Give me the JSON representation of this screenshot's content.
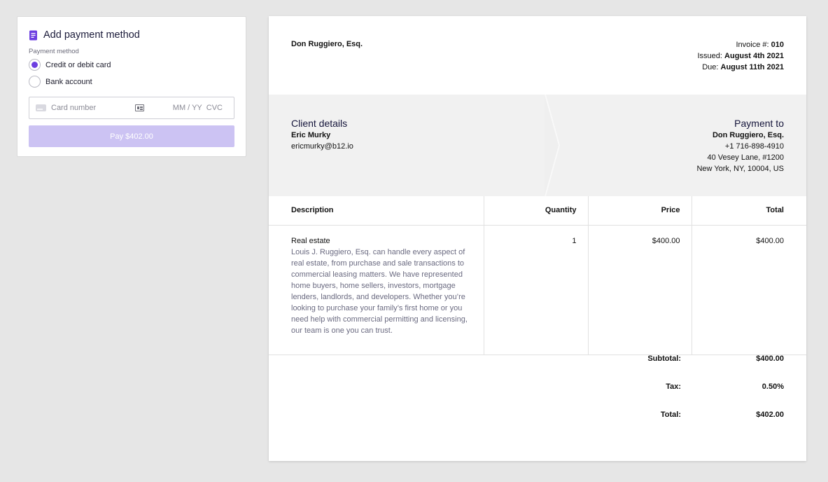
{
  "payment": {
    "title": "Add payment method",
    "method_label": "Payment method",
    "options": [
      {
        "label": "Credit or debit card",
        "selected": true
      },
      {
        "label": "Bank account",
        "selected": false
      }
    ],
    "card_number_placeholder": "Card number",
    "expiry_placeholder": "MM / YY",
    "cvc_placeholder": "CVC",
    "pay_button": "Pay $402.00",
    "accent_color": "#6d3fe0"
  },
  "invoice": {
    "from_name": "Don Ruggiero, Esq.",
    "number_label": "Invoice #:",
    "number": "010",
    "issued_label": "Issued:",
    "issued": "August 4th 2021",
    "due_label": "Due:",
    "due": "August 11th 2021",
    "client": {
      "heading": "Client details",
      "name": "Eric Murky",
      "email": "ericmurky@b12.io"
    },
    "payto": {
      "heading": "Payment to",
      "name": "Don Ruggiero, Esq.",
      "phone": "+1 716-898-4910",
      "address1": "40 Vesey Lane, #1200",
      "address2": "New York, NY, 10004, US"
    },
    "columns": {
      "description": "Description",
      "quantity": "Quantity",
      "price": "Price",
      "total": "Total"
    },
    "items": [
      {
        "name": "Real estate",
        "description": "Louis J. Ruggiero, Esq. can handle every aspect of real estate, from purchase and sale transactions to commercial leasing matters. We have represented home buyers, home sellers, investors, mortgage lenders, landlords, and developers. Whether you’re looking to purchase your family’s first home or you need help with commercial permitting and licensing, our team is one you can trust.",
        "quantity": "1",
        "price": "$400.00",
        "total": "$400.00"
      }
    ],
    "totals": {
      "subtotal_label": "Subtotal:",
      "subtotal": "$400.00",
      "tax_label": "Tax:",
      "tax": "0.50%",
      "total_label": "Total:",
      "total": "$402.00"
    }
  }
}
